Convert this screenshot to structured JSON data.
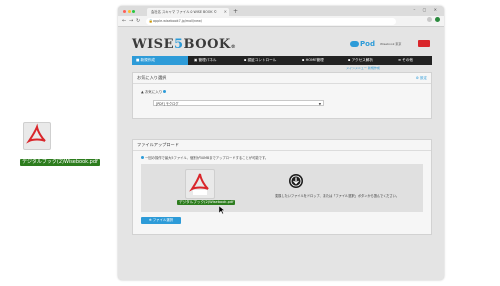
{
  "desktop": {
    "file_label": "デジタルブック(2)Wisebook.pdf",
    "file_icon": "pdf-icon"
  },
  "browser": {
    "tab_title": "会社名 スキャマ ファイル 0 WISE BOOK ©",
    "url": "apple.wisebook7.jp/moll/new/",
    "window_controls": "– ▢ ✕"
  },
  "app": {
    "logo_prefix": "WISE",
    "logo_digit": "5",
    "logo_suffix": "BOOK",
    "logo_mark": "®",
    "pod_label": "Pod",
    "user_label": "Wisebook 東京",
    "nav": [
      {
        "label": "新規作成",
        "icon": "plus-icon",
        "active": true
      },
      {
        "label": "管理パネル",
        "icon": "panel-icon",
        "active": false
      },
      {
        "label": "認証コントロール",
        "icon": "lock-icon",
        "active": false
      },
      {
        "label": "HOME管理",
        "icon": "home-icon",
        "active": false
      },
      {
        "label": "アクセス解析",
        "icon": "chart-icon",
        "active": false
      },
      {
        "label": "その他",
        "icon": "menu-icon",
        "active": false
      }
    ],
    "breadcrumb": "メインメニュー 新規作成",
    "favorite_panel": {
      "title": "お気に入り選択",
      "setting_label": "設定",
      "field_label": "お気に入り",
      "select_value": "[PDF] モクログ"
    },
    "upload_panel": {
      "title": "ファイルアップロード",
      "note": "一回の操作で最大5ファイル、個別が50MBまでアップロードすることが可能です。",
      "drop_text": "変換したいファイルをドロップ、または「ファイル選択」ボタンから選んでください。",
      "drag_file_label": "デジタルブック(2)Wisebook.pdf",
      "choose_button": "ファイル選択"
    }
  },
  "colors": {
    "accent": "#2d9bd8",
    "pdf_red": "#d9262b",
    "label_green": "#2d7d1e",
    "nav_bg": "#222222"
  }
}
